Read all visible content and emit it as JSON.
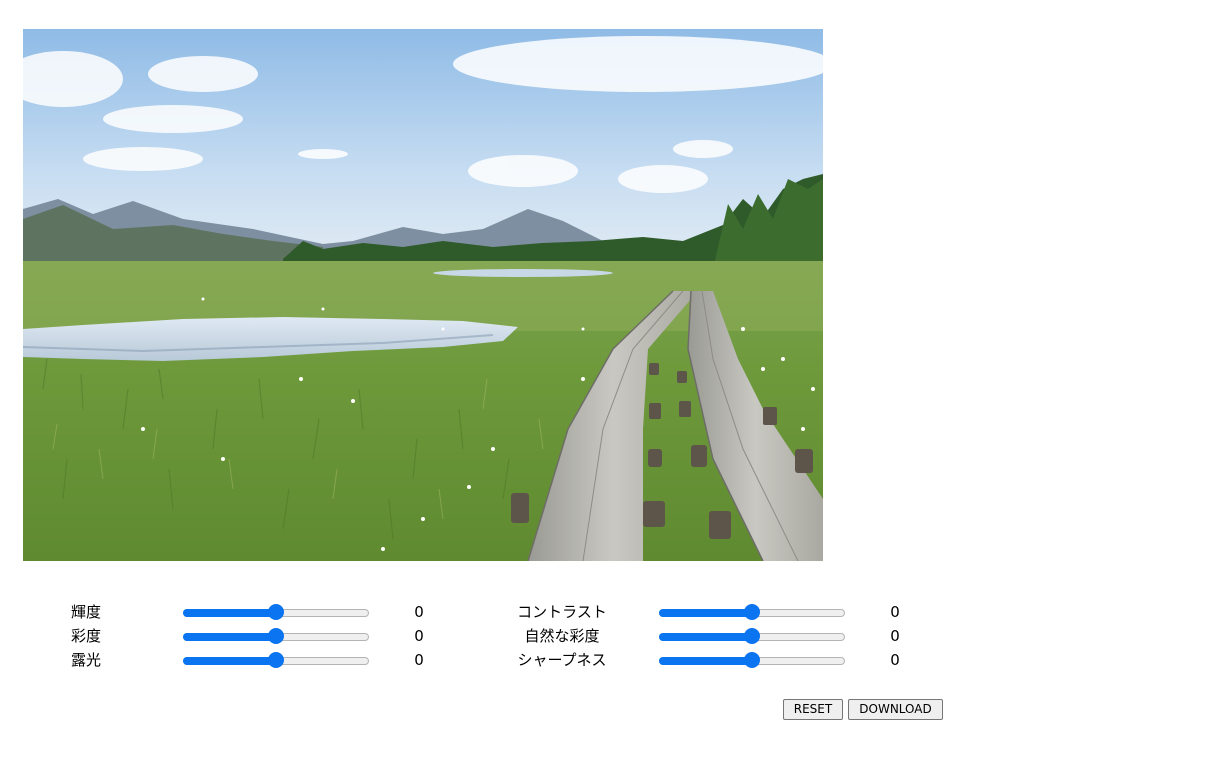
{
  "photo": {
    "alt": "湿原の木道"
  },
  "controls": {
    "left": [
      {
        "key": "brightness",
        "label": "輝度",
        "value": "0",
        "level": 0.5
      },
      {
        "key": "saturation",
        "label": "彩度",
        "value": "0",
        "level": 0.5
      },
      {
        "key": "exposure",
        "label": "露光",
        "value": "0",
        "level": 0.5
      }
    ],
    "right": [
      {
        "key": "contrast",
        "label": "コントラスト",
        "value": "0",
        "level": 0.5
      },
      {
        "key": "vibrance",
        "label": "自然な彩度",
        "value": "0",
        "level": 0.5
      },
      {
        "key": "sharpness",
        "label": "シャープネス",
        "value": "0",
        "level": 0.5
      }
    ]
  },
  "buttons": {
    "reset": "RESET",
    "download": "DOWNLOAD"
  },
  "colors": {
    "accent": "#0a74f1"
  }
}
